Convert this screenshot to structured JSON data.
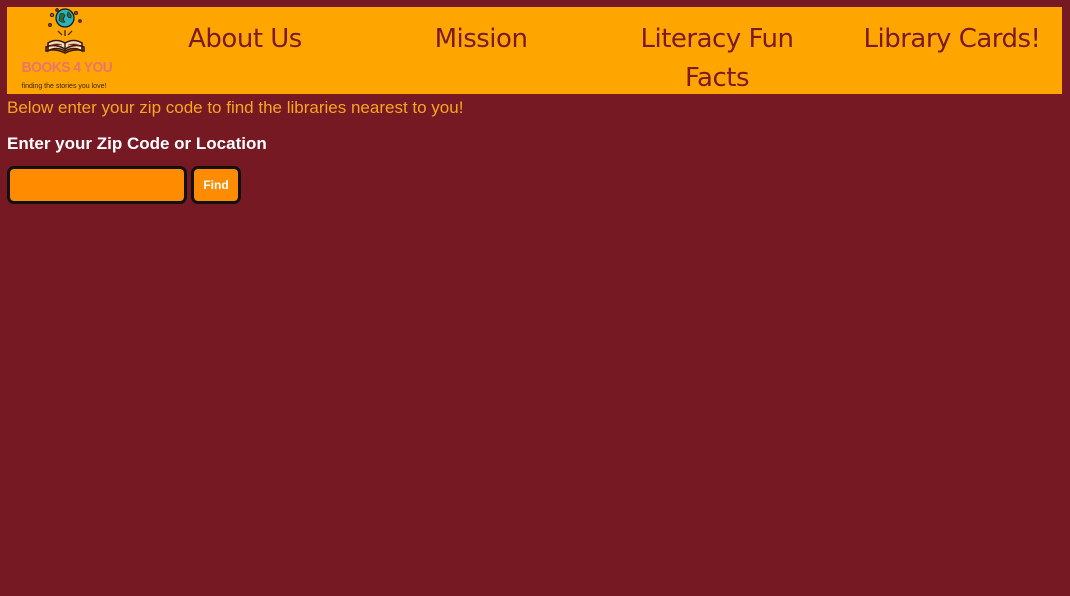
{
  "logo": {
    "title": "BOOKS 4 YOU",
    "tagline": "finding the stories you love!",
    "icon": "globe-book-icon",
    "colors": {
      "globe": "#2BB3B8",
      "book": "#3A1A0A",
      "title": "#E8766A"
    }
  },
  "nav": {
    "about": "About Us",
    "mission": "Mission",
    "facts_line1": "Literacy Fun",
    "facts_line2": "Facts",
    "cards": "Library Cards!"
  },
  "intro": "Below enter your zip code to find the libraries nearest to you!",
  "search": {
    "label": "Enter your Zip Code or Location",
    "value": "",
    "placeholder": "",
    "button_label": "Find"
  },
  "colors": {
    "background": "#771923",
    "header": "#FFA500",
    "nav_text": "#7A1A24",
    "intro_text": "#F5A623",
    "input_fill": "#FF8C00"
  }
}
